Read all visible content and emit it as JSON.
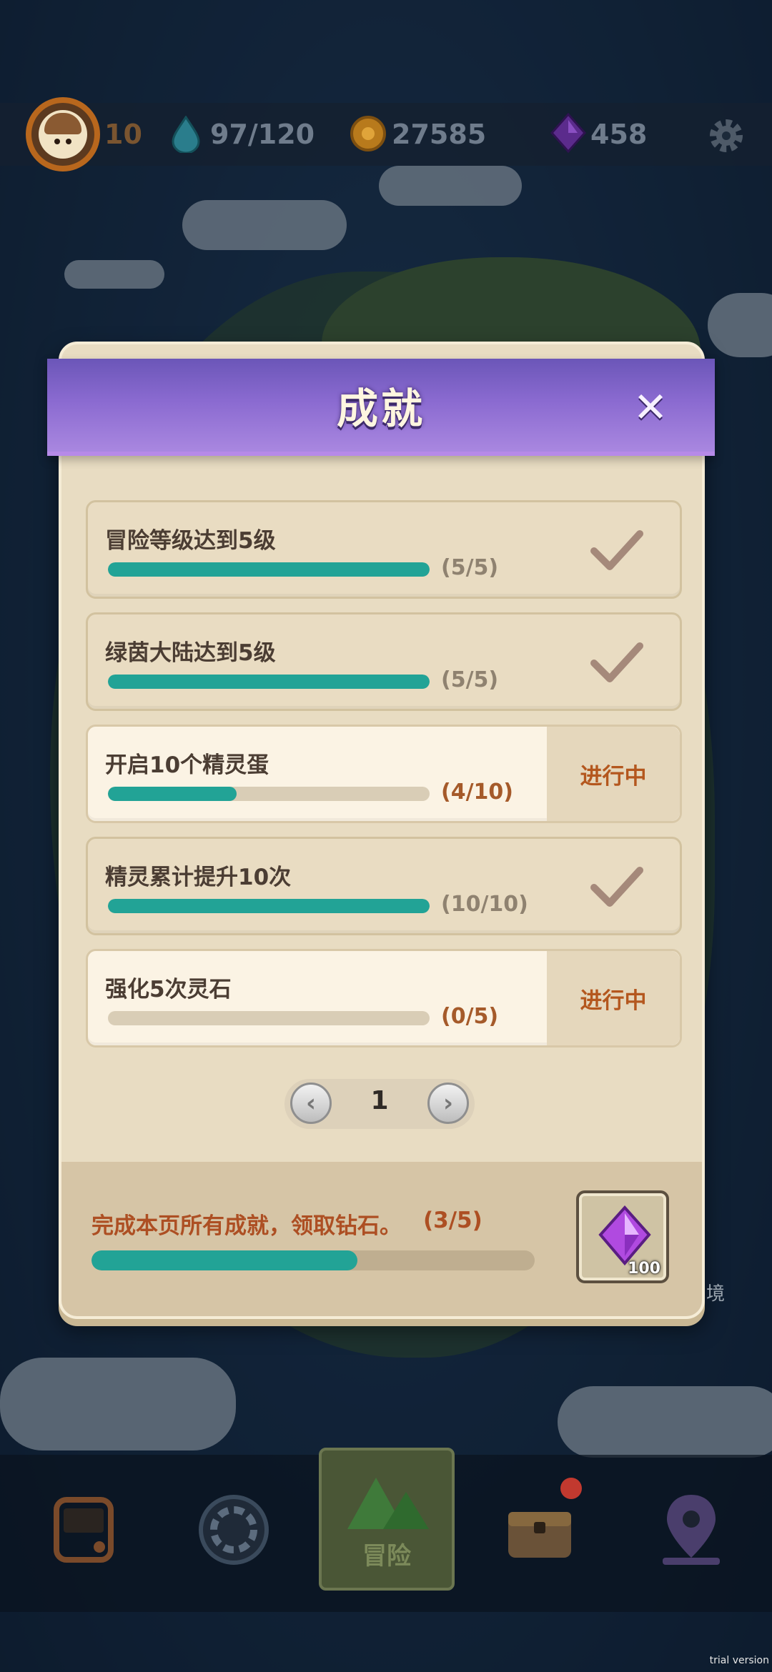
{
  "hud": {
    "level": "10",
    "energy": "97/120",
    "coins": "27585",
    "gems": "458"
  },
  "dialog": {
    "title": "成就",
    "close_glyph": "✕",
    "achievements": [
      {
        "title": "冒险等级达到5级",
        "count": "(5/5)",
        "progress": 1.0,
        "status": "done"
      },
      {
        "title": "绿茵大陆达到5级",
        "count": "(5/5)",
        "progress": 1.0,
        "status": "done"
      },
      {
        "title": "开启10个精灵蛋",
        "count": "(4/10)",
        "progress": 0.4,
        "status": "进行中"
      },
      {
        "title": "精灵累计提升10次",
        "count": "(10/10)",
        "progress": 1.0,
        "status": "done"
      },
      {
        "title": "强化5次灵石",
        "count": "(0/5)",
        "progress": 0.0,
        "status": "进行中"
      }
    ],
    "pager": {
      "page": "1",
      "prev_glyph": "‹",
      "next_glyph": "›"
    },
    "footer": {
      "text": "完成本页所有成就，领取钻石。",
      "count": "(3/5)",
      "progress": 0.6,
      "reward_qty": "100"
    }
  },
  "nav": {
    "active_label": "冒险",
    "map_fragment": "境"
  },
  "watermark": "trial version",
  "colors": {
    "accent_teal": "#22a396",
    "header_purple": "#7a5fc4",
    "in_progress_text": "#b4571e",
    "panel_bg": "#e8dcc2"
  },
  "icons": [
    "avatar",
    "water-drop-icon",
    "coin-icon",
    "gem-icon",
    "gear-icon",
    "close-icon",
    "check-icon",
    "chevron-left-icon",
    "chevron-right-icon",
    "arcade-icon",
    "portal-icon",
    "mountain-icon",
    "chest-icon",
    "map-pin-icon"
  ]
}
